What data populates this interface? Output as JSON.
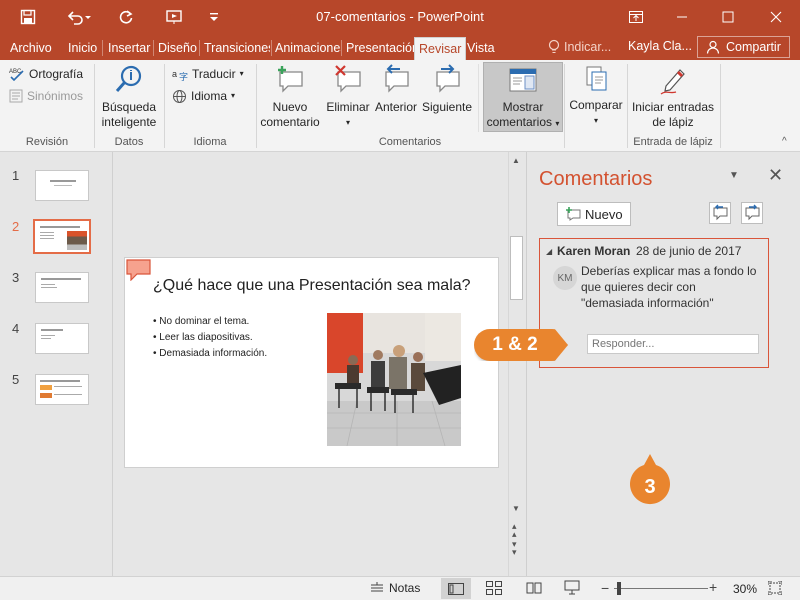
{
  "window": {
    "title": "07-comentarios  -  PowerPoint",
    "accent": "#b7472a"
  },
  "tabs": [
    "Archivo",
    "Inicio",
    "Insertar",
    "Diseño",
    "Transiciones",
    "Animaciones",
    "Presentación",
    "Revisar",
    "Vista"
  ],
  "tell_me": "Indicar...",
  "user": "Kayla Cla...",
  "share": "Compartir",
  "ribbon": {
    "proofing": {
      "spelling": "Ortografía",
      "thesaurus": "Sinónimos",
      "label": "Revisión"
    },
    "insights": {
      "smart_lookup_line1": "Búsqueda",
      "smart_lookup_line2": "inteligente",
      "label": "Datos"
    },
    "language": {
      "translate": "Traducir",
      "language": "Idioma",
      "label": "Idioma"
    },
    "comments": {
      "new_line1": "Nuevo",
      "new_line2": "comentario",
      "delete": "Eliminar",
      "previous": "Anterior",
      "next": "Siguiente",
      "show_line1": "Mostrar",
      "show_line2": "comentarios",
      "label": "Comentarios"
    },
    "compare": {
      "compare": "Comparar"
    },
    "ink": {
      "start_line1": "Iniciar entradas",
      "start_line2": "de lápiz",
      "label": "Entrada de lápiz"
    }
  },
  "thumbnails": [
    "1",
    "2",
    "3",
    "4",
    "5"
  ],
  "slide": {
    "title": "¿Qué hace que una Presentación sea mala?",
    "bullets": [
      "No dominar el tema.",
      "Leer las diapositivas.",
      "Demasiada información."
    ]
  },
  "comments_pane": {
    "title": "Comentarios",
    "new_button": "Nuevo",
    "comment": {
      "author": "Karen Moran",
      "date": "28 de junio de 2017",
      "initials": "KM",
      "text_line1": "Deberías explicar mas a fondo lo",
      "text_line2": "que quieres decir con",
      "text_line3": "\"demasiada información\""
    },
    "reply_placeholder": "Responder..."
  },
  "callouts": {
    "first": "1 & 2",
    "second": "3"
  },
  "status": {
    "notes": "Notas",
    "zoom": "30%"
  }
}
